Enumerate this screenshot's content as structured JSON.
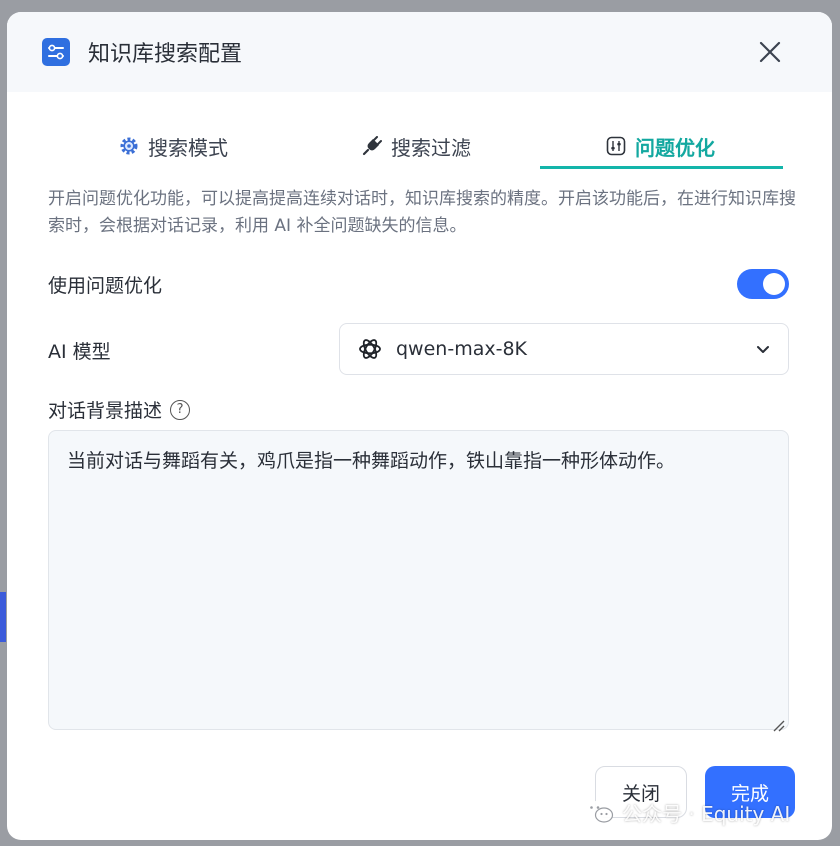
{
  "dialog": {
    "title": "知识库搜索配置"
  },
  "tabs": [
    {
      "label": "搜索模式",
      "icon": "gear-icon",
      "active": false
    },
    {
      "label": "搜索过滤",
      "icon": "plug-icon",
      "active": false
    },
    {
      "label": "问题优化",
      "icon": "tune-icon",
      "active": true
    }
  ],
  "description": "开启问题优化功能，可以提高提高连续对话时，知识库搜索的精度。开启该功能后，在进行知识库搜索时，会根据对话记录，利用 AI 补全问题缺失的信息。",
  "toggle": {
    "label": "使用问题优化",
    "enabled": true
  },
  "model": {
    "label": "AI 模型",
    "value": "qwen-max-8K"
  },
  "background": {
    "label": "对话背景描述",
    "help_glyph": "?",
    "value": "当前对话与舞蹈有关，鸡爪是指一种舞蹈动作，铁山靠指一种形体动作。"
  },
  "footer": {
    "close_label": "关闭",
    "done_label": "完成"
  },
  "watermark": {
    "text": "公众号 · Equity AI"
  },
  "colors": {
    "accent": "#3370ff",
    "tab_active": "#13a8a0"
  }
}
